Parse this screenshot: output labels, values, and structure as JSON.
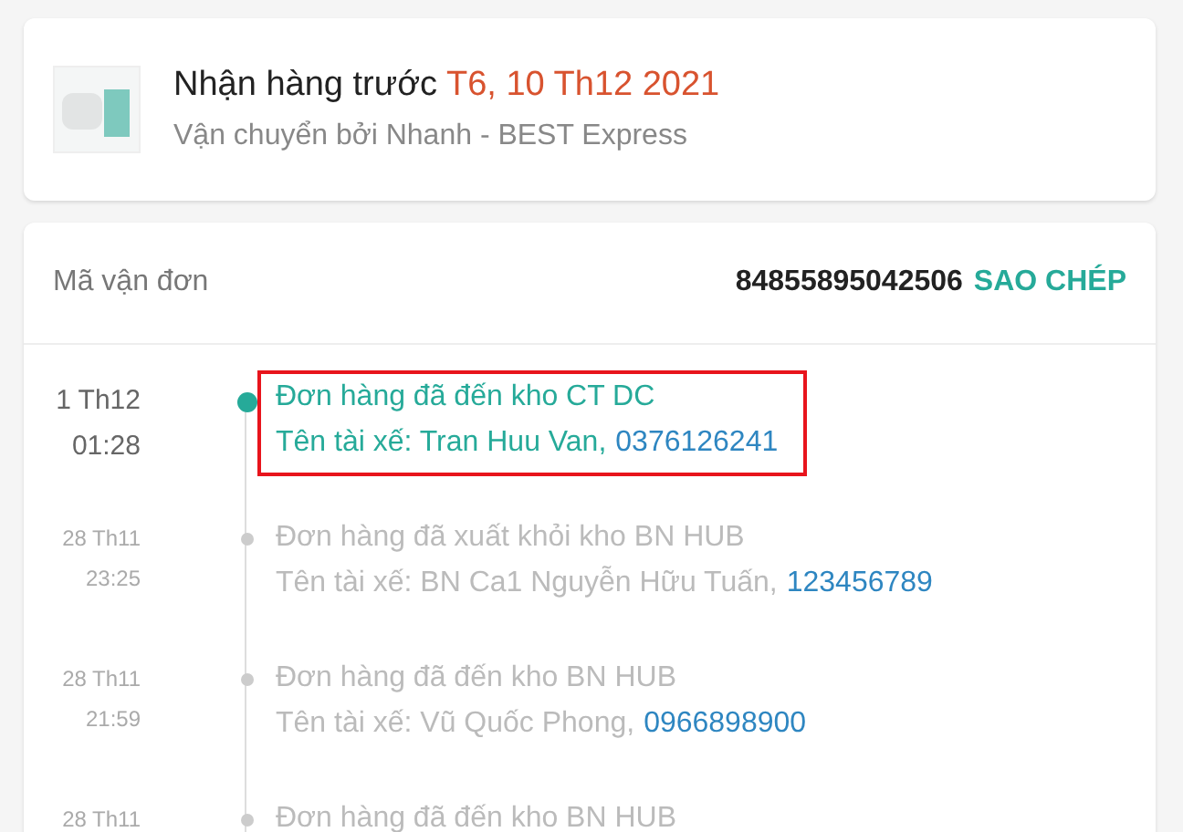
{
  "delivery": {
    "title": "Nhận hàng trước",
    "date": "T6, 10 Th12 2021",
    "carrier": "Vận chuyển bởi Nhanh - BEST Express"
  },
  "tracking": {
    "label": "Mã vận đơn",
    "number": "84855895042506",
    "copy": "SAO CHÉP"
  },
  "events": [
    {
      "date": "1 Th12",
      "time": "01:28",
      "title": "Đơn hàng đã đến kho CT DC",
      "driver": "Tên tài xế: Tran Huu Van,",
      "phone": "0376126241",
      "active": true,
      "highlighted": true
    },
    {
      "date": "28 Th11",
      "time": "23:25",
      "title": "Đơn hàng đã xuất khỏi kho BN HUB",
      "driver": "Tên tài xế: BN Ca1 Nguyễn Hữu Tuấn,",
      "phone": "123456789",
      "active": false,
      "highlighted": false
    },
    {
      "date": "28 Th11",
      "time": "21:59",
      "title": "Đơn hàng đã đến kho BN HUB",
      "driver": "Tên tài xế: Vũ Quốc Phong,",
      "phone": "0966898900",
      "active": false,
      "highlighted": false
    },
    {
      "date": "28 Th11",
      "title": "Đơn hàng đã đến kho BN HUB",
      "active": false,
      "highlighted": false
    }
  ]
}
